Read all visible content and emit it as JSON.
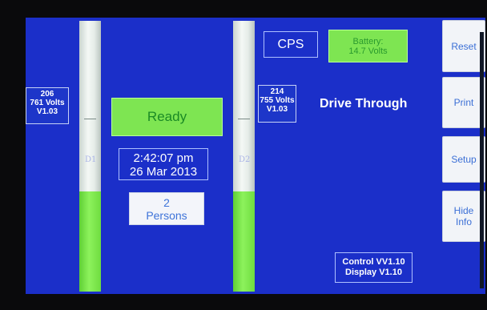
{
  "detector1": {
    "id_label": "D1",
    "readout": {
      "line1": "206",
      "line2": "761 Volts",
      "line3": "V1.03"
    },
    "level": 0.37
  },
  "detector2": {
    "id_label": "D2",
    "readout": {
      "line1": "214",
      "line2": "755 Volts",
      "line3": "V1.03"
    },
    "level": 0.37
  },
  "status": {
    "label": "Ready"
  },
  "clock": {
    "time": "2:42:07 pm",
    "date": "26 Mar 2013"
  },
  "persons": {
    "count": "2",
    "label": "Persons"
  },
  "mode": {
    "cps_label": "CPS",
    "title": "Drive Through"
  },
  "battery": {
    "line1": "Battery:",
    "line2": "14.7 Volts"
  },
  "side_buttons": {
    "reset": "Reset",
    "print": "Print",
    "setup": "Setup",
    "hide_line1": "Hide",
    "hide_line2": "Info"
  },
  "versions": {
    "control": "Control VV1.10",
    "display": "Display V1.10"
  },
  "colors": {
    "screen_bg": "#1b2fc9",
    "ready_green": "#7ee552",
    "level_green": "#6fdc40"
  }
}
